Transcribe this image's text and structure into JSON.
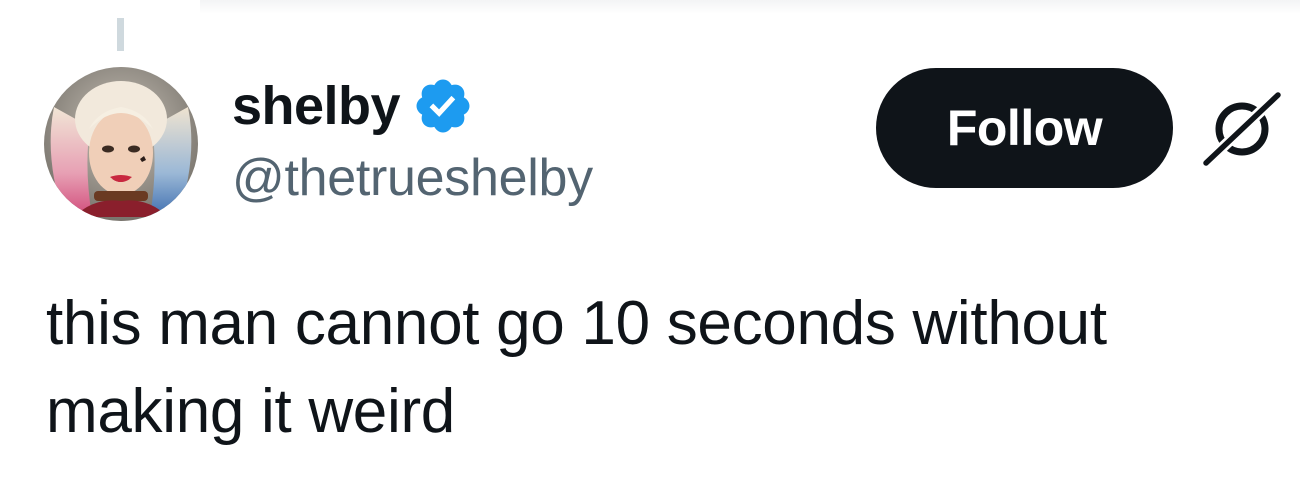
{
  "tweet": {
    "author": {
      "display_name": "shelby",
      "handle": "@thetrueshelby",
      "verified": true,
      "avatar_icon": "avatar-photo"
    },
    "follow_label": "Follow",
    "text": "this man cannot go 10 seconds without making it weird",
    "grok_icon": "grok-icon"
  },
  "colors": {
    "verified_blue": "#1d9bf0",
    "follow_bg": "#0f1419",
    "handle_gray": "#536471",
    "text": "#0f1419"
  }
}
